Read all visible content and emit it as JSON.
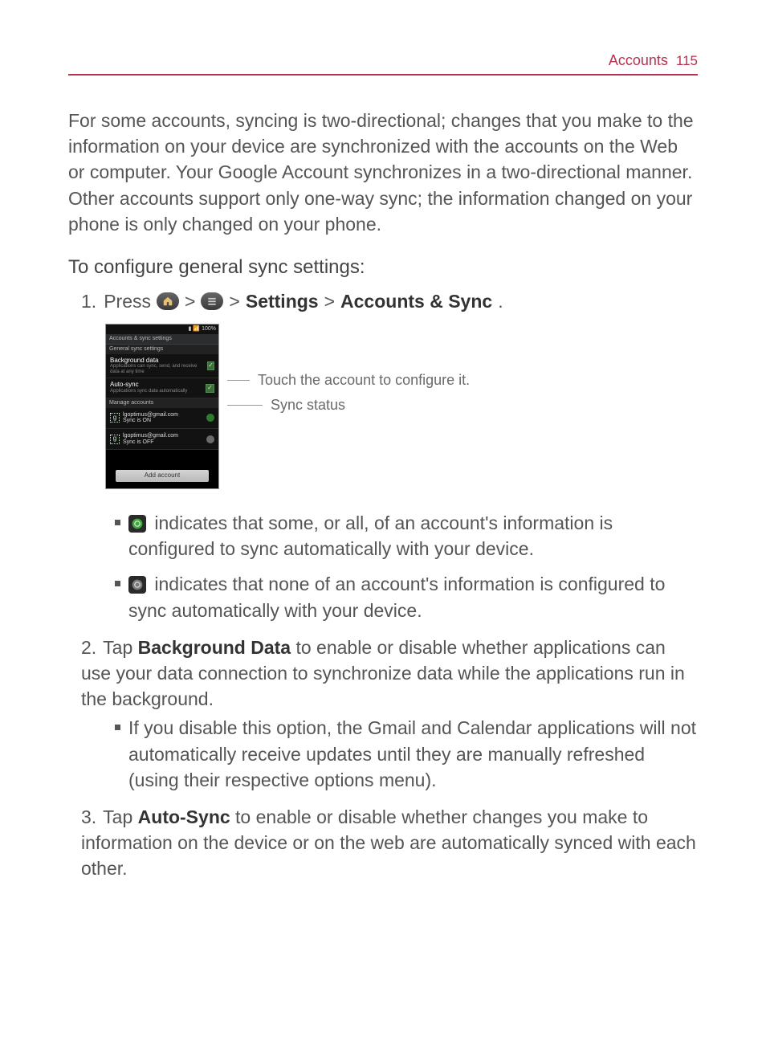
{
  "header": {
    "section": "Accounts",
    "page": "115"
  },
  "intro": "For some accounts, syncing is two-directional; changes that you make to the information on your device are synchronized with the accounts on the Web or computer. Your Google Account synchronizes in a two-directional manner. Other accounts support only one-way sync; the information changed on your phone is only changed on your phone.",
  "subhead": "To configure general sync settings:",
  "step1": {
    "num": "1.",
    "press": "Press",
    "settings": "Settings",
    "accsync": "Accounts & Sync",
    "sep": ">"
  },
  "callouts": {
    "configure": "Touch the account to configure it.",
    "status": "Sync status"
  },
  "screenshot": {
    "status_bar": "100%",
    "title": "Accounts & sync settings",
    "section1": "General sync settings",
    "item1": {
      "t1": "Background data",
      "t2": "Applications can sync, send, and receive data at any time"
    },
    "item2": {
      "t1": "Auto-sync",
      "t2": "Applications sync data automatically"
    },
    "section2": "Manage accounts",
    "acct1": {
      "email": "lgoptimus@gmail.com",
      "sub": "Sync is ON"
    },
    "acct2": {
      "email": "lgoptimus@gmail.com",
      "sub": "Sync is OFF"
    },
    "button": "Add account"
  },
  "bullets": {
    "green": "indicates that some, or all, of an account's information is configured to sync automatically with your device.",
    "gray": "indicates that none of an account's information is configured to sync automatically with your device."
  },
  "step2": {
    "num": "2.",
    "pre": "Tap ",
    "bold": "Background Data",
    "post": " to enable or disable whether applications can use your data connection to synchronize data while the applications run in the background.",
    "sub": "If you disable this option, the Gmail and Calendar applications will not automatically receive updates until they are manually refreshed (using their respective options menu)."
  },
  "step3": {
    "num": "3.",
    "pre": "Tap ",
    "bold": "Auto-Sync",
    "post": " to enable or disable whether changes you make to information on the device or on the web are automatically synced with each other."
  }
}
